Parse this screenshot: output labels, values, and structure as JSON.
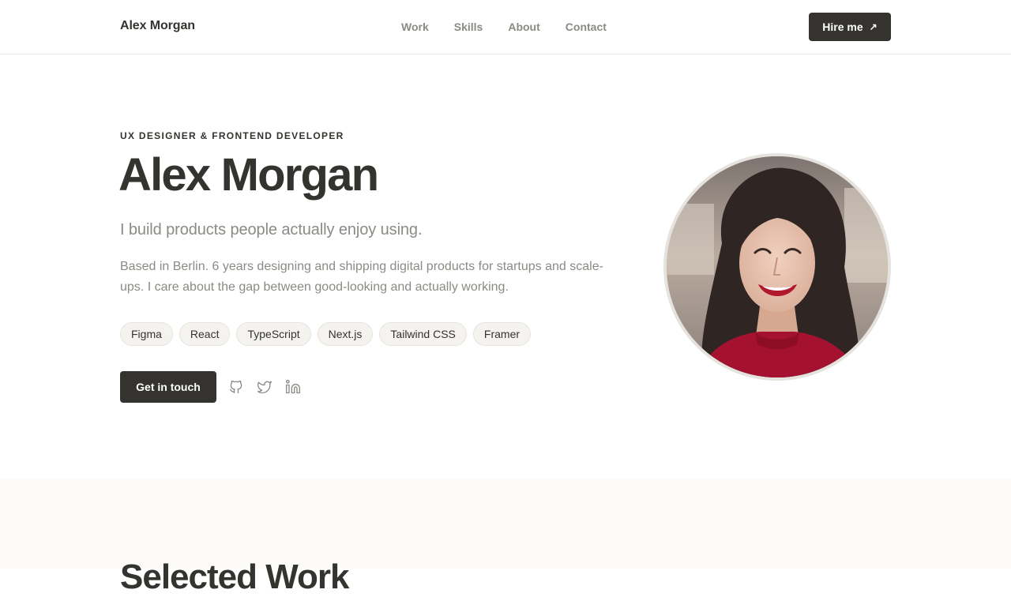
{
  "header": {
    "brand": "Alex Morgan",
    "nav": [
      "Work",
      "Skills",
      "About",
      "Contact"
    ],
    "hire_label": "Hire me",
    "hire_icon": "arrow-up-right-icon"
  },
  "hero": {
    "eyebrow": "UX DESIGNER & FRONTEND DEVELOPER",
    "title": "Alex Morgan",
    "tagline": "I build products people actually enjoy using.",
    "bio": "Based in Berlin. 6 years designing and shipping digital products for startups and scale-ups. I care about the gap between good-looking and actually working.",
    "tags": [
      "Figma",
      "React",
      "TypeScript",
      "Next.js",
      "Tailwind CSS",
      "Framer"
    ],
    "cta_label": "Get in touch",
    "socials": [
      "github-icon",
      "twitter-icon",
      "linkedin-icon"
    ]
  },
  "work": {
    "title": "Selected Work"
  },
  "colors": {
    "primary": "#34332f",
    "muted": "#8c8a85",
    "tag_bg": "#f5f3ef",
    "section_bg": "#fcfbf9"
  }
}
